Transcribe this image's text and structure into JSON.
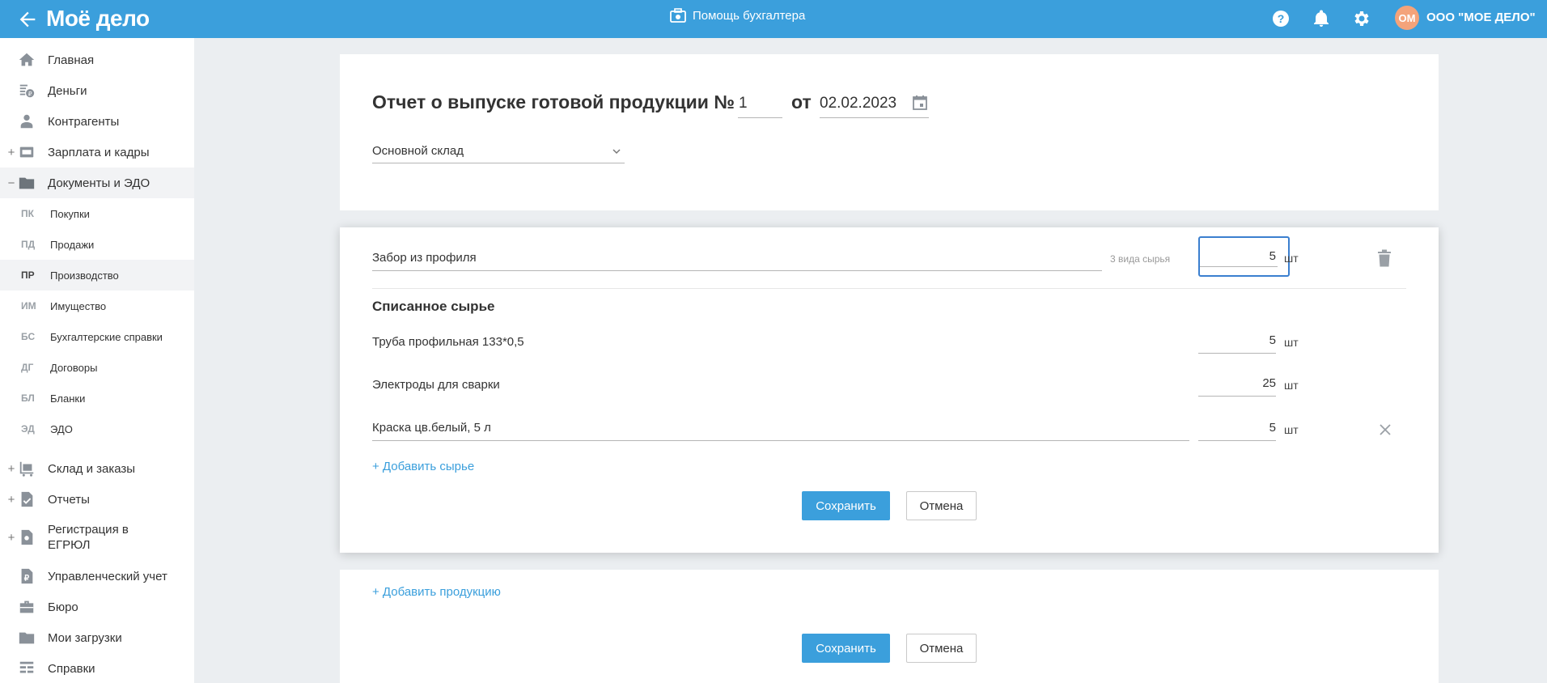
{
  "header": {
    "logo": "Моё дело",
    "helper_label": "Помощь бухгалтера",
    "avatar_initials": "ОМ",
    "company_name": "ООО \"МОЕ ДЕЛО\""
  },
  "sidebar": {
    "items": [
      {
        "label": "Главная",
        "icon": "home-icon"
      },
      {
        "label": "Деньги",
        "icon": "money-icon"
      },
      {
        "label": "Контрагенты",
        "icon": "contractors-icon"
      },
      {
        "label": "Зарплата и кадры",
        "icon": "salary-icon",
        "expander": "+"
      },
      {
        "label": "Документы и ЭДО",
        "icon": "folder-icon",
        "expander": "−"
      },
      {
        "label": "Склад и заказы",
        "icon": "warehouse-icon",
        "expander": "+"
      },
      {
        "label": "Отчеты",
        "icon": "reports-icon",
        "expander": "+"
      },
      {
        "label": "Регистрация в ЕГРЮЛ",
        "icon": "registration-icon",
        "expander": "+"
      },
      {
        "label": "Управленческий учет",
        "icon": "management-icon"
      },
      {
        "label": "Бюро",
        "icon": "briefcase-icon"
      },
      {
        "label": "Мои загрузки",
        "icon": "folder-icon"
      },
      {
        "label": "Справки",
        "icon": "references-icon"
      }
    ],
    "subitems": [
      {
        "abbr": "ПК",
        "label": "Покупки"
      },
      {
        "abbr": "ПД",
        "label": "Продажи"
      },
      {
        "abbr": "ПР",
        "label": "Производство"
      },
      {
        "abbr": "ИМ",
        "label": "Имущество"
      },
      {
        "abbr": "БС",
        "label": "Бухгалтерские справки"
      },
      {
        "abbr": "ДГ",
        "label": "Договоры"
      },
      {
        "abbr": "БЛ",
        "label": "Бланки"
      },
      {
        "abbr": "ЭД",
        "label": "ЭДО"
      }
    ]
  },
  "document": {
    "title": "Отчет о выпуске готовой продукции №",
    "number": "1",
    "date_prefix": "от",
    "date": "02.02.2023",
    "warehouse": "Основной склад"
  },
  "product": {
    "name": "Забор из профиля",
    "raw_count": "3 вида сырья",
    "quantity": "5",
    "unit": "шт",
    "section_title": "Списанное сырье",
    "materials": [
      {
        "name": "Труба профильная 133*0,5",
        "quantity": "5",
        "unit": "шт"
      },
      {
        "name": "Электроды для сварки",
        "quantity": "25",
        "unit": "шт"
      },
      {
        "name": "Краска цв.белый, 5 л",
        "quantity": "5",
        "unit": "шт"
      }
    ],
    "add_material_link": "+ Добавить сырье",
    "save_label": "Сохранить",
    "cancel_label": "Отмена"
  },
  "footer": {
    "add_product_link": "+ Добавить продукцию",
    "save_label": "Сохранить",
    "cancel_label": "Отмена"
  },
  "colors": {
    "brand": "#3b9fdc",
    "focus": "#3b7fcf",
    "avatar": "#f4a37a"
  }
}
